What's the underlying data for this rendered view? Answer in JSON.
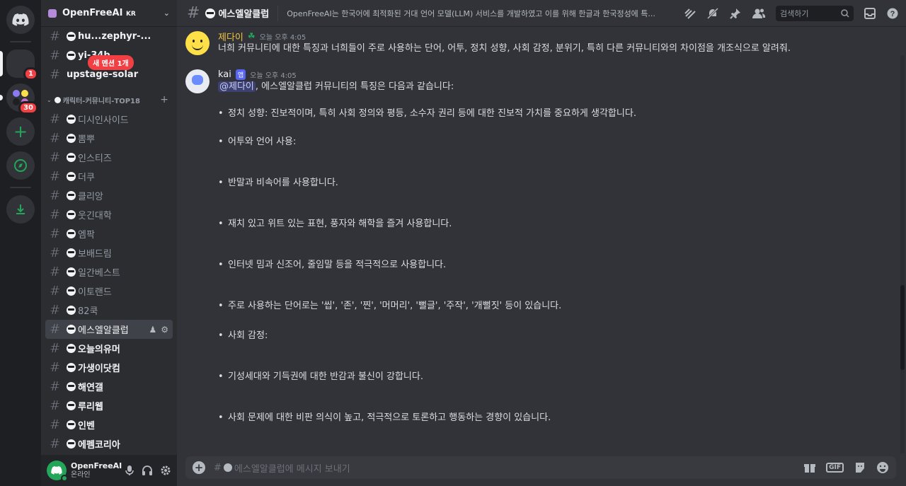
{
  "rail": {
    "servers": [
      {
        "name": "home",
        "icon": "discord-icon"
      },
      {
        "name": "server-globe",
        "badge": "1"
      },
      {
        "name": "server-group",
        "badge": "30"
      }
    ]
  },
  "sidebar": {
    "guild_name": "OpenFreeAI",
    "guild_suffix": "KR",
    "new_mention": "새 멘션 1개",
    "top_channels": [
      {
        "name": "hu...zephyr-...",
        "unread": true,
        "emoji": true
      },
      {
        "name": "yi-34b",
        "unread": true,
        "emoji": true
      },
      {
        "name": "upstage-solar",
        "unread": true,
        "emoji": false
      }
    ],
    "category": "캐릭터-커뮤니티-TOP18",
    "channels": [
      {
        "name": "디시인사이드",
        "unread": false
      },
      {
        "name": "뽐뿌",
        "unread": false
      },
      {
        "name": "인스티즈",
        "unread": false
      },
      {
        "name": "더쿠",
        "unread": false
      },
      {
        "name": "클리앙",
        "unread": false
      },
      {
        "name": "웃긴대학",
        "unread": false
      },
      {
        "name": "엠팍",
        "unread": false
      },
      {
        "name": "보배드림",
        "unread": false
      },
      {
        "name": "일간베스트",
        "unread": false
      },
      {
        "name": "이토랜드",
        "unread": false
      },
      {
        "name": "82쿡",
        "unread": false
      },
      {
        "name": "에스엘알클럽",
        "unread": false,
        "selected": true
      },
      {
        "name": "오늘의유머",
        "unread": true
      },
      {
        "name": "가생이닷컴",
        "unread": true
      },
      {
        "name": "해연갤",
        "unread": true
      },
      {
        "name": "루리웹",
        "unread": true
      },
      {
        "name": "인벤",
        "unread": true
      },
      {
        "name": "에펨코리아",
        "unread": true
      }
    ],
    "user": {
      "name": "OpenFreeAI",
      "status": "온라인"
    }
  },
  "header": {
    "channel_name": "에스엘알클럽",
    "topic": "OpenFreeAI는 한국어에 최적화된 거대 언어 모델(LLM) 서비스를 개발하였고 이를 위해 한글과 한국정성에 특...",
    "search_placeholder": "검색하기"
  },
  "messages": [
    {
      "author": "제다이",
      "time": "오늘 오후 4:05",
      "text": "너희 커뮤니티에 대한 특징과 너희들이 주로 사용하는 단어, 어투, 정치 성향, 사회 감정, 분위기, 특히 다른 커뮤니티와의 차이점을 개조식으로 알려줘."
    },
    {
      "author": "kai",
      "tag": "앱",
      "time": "오늘 오후 4:05",
      "mention": "@제다이",
      "intro": ", 에스엘알클럽 커뮤니티의 특징은 다음과 같습니다:",
      "bullets": [
        "정치 성향: 진보적이며, 특히 사회 정의와 평등, 소수자 권리 등에 대한 진보적 가치를 중요하게 생각합니다.",
        "어투와 언어 사용:",
        "반말과 비속어를 사용합니다.",
        "재치 있고 위트 있는 표현, 풍자와 해학을 즐겨 사용합니다.",
        "인터넷 밈과 신조어, 줄임말 등을 적극적으로 사용합니다.",
        "주로 사용하는 단어로는 '씹', '존', '찐', '머머리', '뻘글', '주작', '개뻘짓' 등이 있습니다.",
        "사회 감정:",
        "기성세대와 기득권에 대한 반감과 불신이 강합니다.",
        "사회 문제에 대한 비판 의식이 높고, 적극적으로 토론하고 행동하는 경향이 있습니다."
      ]
    }
  ],
  "composer": {
    "placeholder": "에스엘알클럽에 메시지 보내기",
    "gif_label": "GIF"
  },
  "colors": {
    "accent": "#5865f2",
    "online": "#23a55a",
    "badge": "#f23f43",
    "author_yellow": "#f0c542"
  }
}
